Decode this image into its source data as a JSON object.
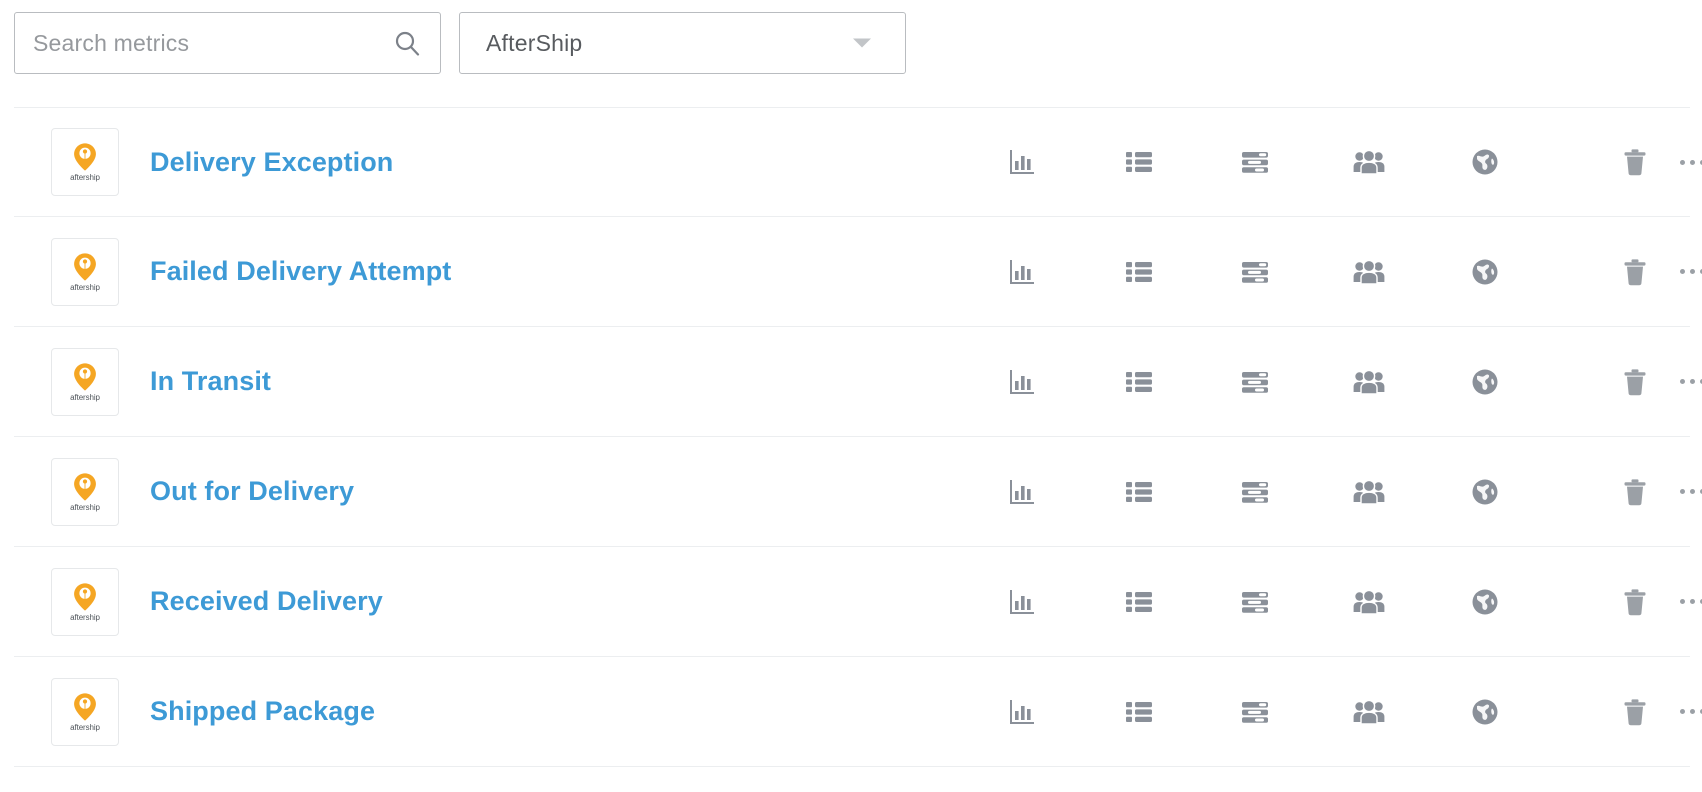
{
  "toolbar": {
    "search": {
      "placeholder": "Search metrics",
      "value": "",
      "icon": "search-icon"
    },
    "integration_filter": {
      "selected": "AfterShip",
      "caret_icon": "chevron-down-icon"
    }
  },
  "colors": {
    "link_blue": "#3d9ad6",
    "icon_gray": "#8a9099",
    "brand_orange": "#f5a623",
    "border_gray": "#b9bcc0",
    "row_divider": "#eceef0",
    "text_gray": "#585b5f",
    "placeholder_gray": "#96999d"
  },
  "list": {
    "brand": {
      "name": "aftership",
      "logo_icon": "aftership-pin-logo"
    },
    "action_icons": [
      {
        "name": "chart-icon",
        "title": "Metric chart"
      },
      {
        "name": "list-icon",
        "title": "Metric list"
      },
      {
        "name": "sliders-icon",
        "title": "Metric settings"
      },
      {
        "name": "people-icon",
        "title": "Audience"
      },
      {
        "name": "globe-icon",
        "title": "Global activity"
      },
      {
        "name": "trash-icon",
        "title": "Delete"
      },
      {
        "name": "ellipsis-icon",
        "title": "More options"
      }
    ],
    "rows": [
      {
        "name": "Delivery Exception"
      },
      {
        "name": "Failed Delivery Attempt"
      },
      {
        "name": "In Transit"
      },
      {
        "name": "Out for Delivery"
      },
      {
        "name": "Received Delivery"
      },
      {
        "name": "Shipped Package"
      }
    ]
  }
}
